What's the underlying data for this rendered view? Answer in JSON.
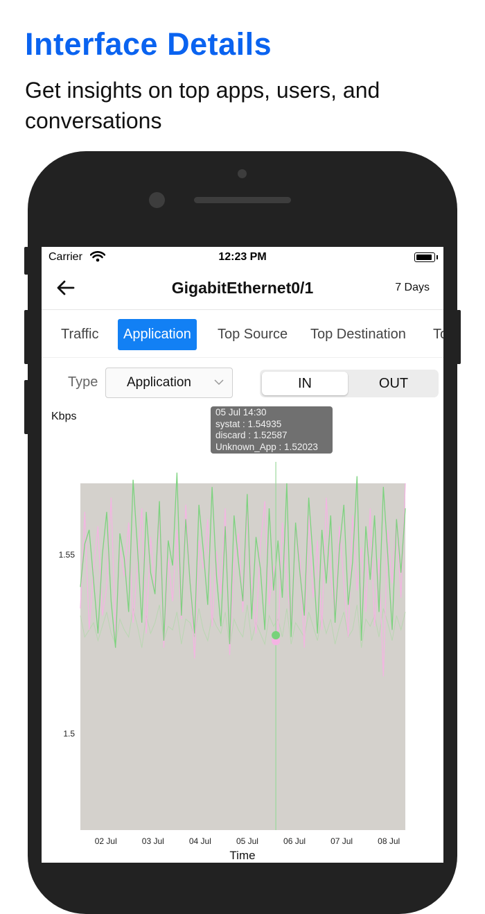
{
  "hero": {
    "title": "Interface Details",
    "subtitle": "Get insights on top apps, users, and conversations"
  },
  "status_bar": {
    "carrier": "Carrier",
    "time": "12:23 PM"
  },
  "nav": {
    "title": "GigabitEthernet0/1",
    "range": "7 Days"
  },
  "tabs": [
    "Traffic",
    "Application",
    "Top Source",
    "Top Destination",
    "To"
  ],
  "active_tab": "Application",
  "filter": {
    "type_label": "Type",
    "type_value": "Application"
  },
  "direction": {
    "in": "IN",
    "out": "OUT",
    "selected": "IN"
  },
  "tooltip": {
    "time": "05 Jul 14:30",
    "lines": [
      "systat : 1.54935",
      "discard : 1.52587",
      "Unknown_App : 1.52023"
    ]
  },
  "colors": {
    "accent": "#1280f4",
    "title_blue": "#0a63f0",
    "green": "#78d27a",
    "pink": "#f4b3e3",
    "area": "#d4d1cc"
  },
  "chart_data": {
    "type": "line",
    "ylabel": "Kbps",
    "xlabel": "Time",
    "yticks": [
      "1.55",
      "1.5"
    ],
    "ylim": [
      1.473,
      1.576
    ],
    "xticks": [
      "02 Jul",
      "03 Jul",
      "04 Jul",
      "05 Jul",
      "06 Jul",
      "07 Jul",
      "08 Jul"
    ],
    "xrange_days": [
      1.46,
      8.35
    ],
    "series": [
      {
        "name": "systat",
        "values": [
          1.541,
          1.553,
          1.557,
          1.543,
          1.528,
          1.55,
          1.562,
          1.537,
          1.524,
          1.556,
          1.549,
          1.534,
          1.571,
          1.552,
          1.531,
          1.562,
          1.545,
          1.539,
          1.565,
          1.526,
          1.554,
          1.547,
          1.573,
          1.533,
          1.56,
          1.542,
          1.528,
          1.564,
          1.551,
          1.536,
          1.569,
          1.544,
          1.53,
          1.558,
          1.525,
          1.561,
          1.548,
          1.537,
          1.567,
          1.532,
          1.555,
          1.546,
          1.529,
          1.563,
          1.54,
          1.554,
          1.538,
          1.57,
          1.527,
          1.559,
          1.545,
          1.533,
          1.566,
          1.549,
          1.528,
          1.557,
          1.542,
          1.561,
          1.531,
          1.552,
          1.564,
          1.536,
          1.548,
          1.572,
          1.526,
          1.558,
          1.543,
          1.561,
          1.534,
          1.569,
          1.55,
          1.529,
          1.56,
          1.545,
          1.563
        ]
      },
      {
        "name": "discard",
        "values": [
          1.535,
          1.562,
          1.529,
          1.546,
          1.558,
          1.533,
          1.541,
          1.566,
          1.527,
          1.552,
          1.544,
          1.559,
          1.531,
          1.547,
          1.563,
          1.528,
          1.555,
          1.54,
          1.561,
          1.524,
          1.549,
          1.537,
          1.557,
          1.532,
          1.564,
          1.543,
          1.521,
          1.554,
          1.546,
          1.56,
          1.53,
          1.551,
          1.539,
          1.563,
          1.522,
          1.548,
          1.556,
          1.534,
          1.562,
          1.541,
          1.528,
          1.553,
          1.565,
          1.536,
          1.547,
          1.526,
          1.559,
          1.543,
          1.531,
          1.557,
          1.549,
          1.524,
          1.561,
          1.538,
          1.554,
          1.529,
          1.566,
          1.545,
          1.533,
          1.558,
          1.542,
          1.527,
          1.561,
          1.54,
          1.552,
          1.534,
          1.563,
          1.53,
          1.549,
          1.516,
          1.557,
          1.542,
          1.56,
          1.538,
          1.57
        ]
      },
      {
        "name": "Unknown_App",
        "values": [
          1.533,
          1.527,
          1.529,
          1.531,
          1.526,
          1.53,
          1.534,
          1.528,
          1.525,
          1.532,
          1.529,
          1.527,
          1.535,
          1.53,
          1.524,
          1.533,
          1.528,
          1.531,
          1.536,
          1.526,
          1.53,
          1.529,
          1.534,
          1.525,
          1.532,
          1.531,
          1.527,
          1.535,
          1.529,
          1.526,
          1.533,
          1.53,
          1.528,
          1.534,
          1.524,
          1.532,
          1.529,
          1.527,
          1.536,
          1.526,
          1.531,
          1.528,
          1.525,
          1.533,
          1.53,
          1.532,
          1.527,
          1.535,
          1.525,
          1.531,
          1.529,
          1.527,
          1.534,
          1.53,
          1.526,
          1.533,
          1.528,
          1.532,
          1.525,
          1.53,
          1.534,
          1.527,
          1.529,
          1.536,
          1.524,
          1.532,
          1.53,
          1.533,
          1.527,
          1.535,
          1.531,
          1.526,
          1.533,
          1.529,
          1.534
        ]
      }
    ]
  }
}
